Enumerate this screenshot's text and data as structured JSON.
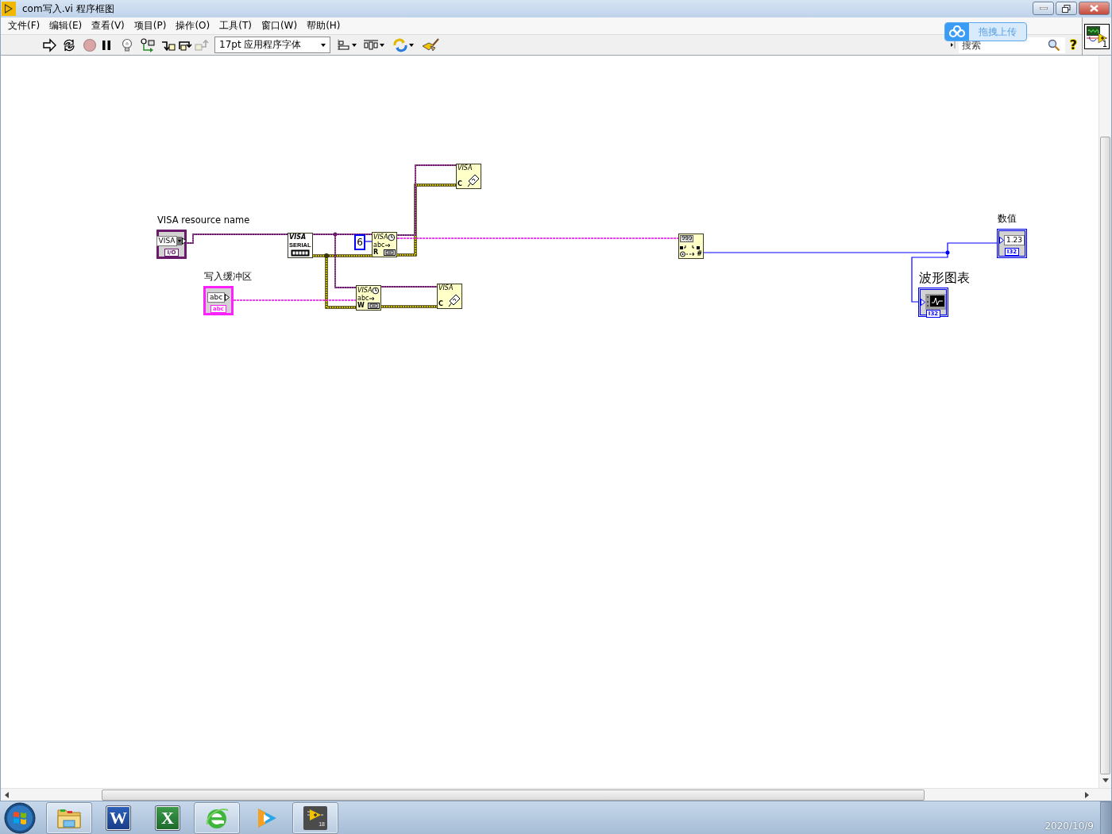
{
  "window": {
    "title": "com写入.vi 程序框图"
  },
  "menu": [
    "文件(F)",
    "编辑(E)",
    "查看(V)",
    "项目(P)",
    "操作(O)",
    "工具(T)",
    "窗口(W)",
    "帮助(H)"
  ],
  "toolbar": {
    "buttons": [
      {
        "kind": "run",
        "disabled": false
      },
      {
        "kind": "run_continuously",
        "disabled": false
      },
      {
        "kind": "abort",
        "disabled": true
      },
      {
        "kind": "pause",
        "disabled": false
      },
      {
        "kind": "highlight",
        "disabled": false
      },
      {
        "kind": "retain",
        "disabled": false
      },
      {
        "kind": "step_into",
        "disabled": false
      },
      {
        "kind": "step_over",
        "disabled": false
      },
      {
        "kind": "step_out",
        "disabled": true
      }
    ],
    "font": "17pt 应用程序字体",
    "search": {
      "placeholder": "搜索"
    },
    "help": "?"
  },
  "icon_pane": {
    "number": "1"
  },
  "upload_widget": {
    "label": "拖拽上传"
  },
  "diagram": {
    "terminals": [
      {
        "kind": "visa",
        "label": "VISA resource name",
        "display": "VISA",
        "type": "I/O",
        "indicator": false
      },
      {
        "kind": "numeric",
        "label": "数值",
        "display": "1.23",
        "type": "I32",
        "indicator": true
      },
      {
        "kind": "string",
        "label": "写入缓冲区",
        "display": "abc",
        "type": "abc",
        "indicator": false
      },
      {
        "kind": "chart",
        "label": "波形图表",
        "type": "I32",
        "indicator": true
      }
    ],
    "constants": [
      {
        "value": "6"
      }
    ],
    "nodes": [
      {
        "kind": "serial",
        "texts": [
          "VISA",
          "SERIAL"
        ]
      },
      {
        "kind": "read",
        "texts": [
          "VISA",
          "abc",
          "R"
        ]
      },
      {
        "kind": "close",
        "texts": [
          "VISA",
          "C"
        ]
      },
      {
        "kind": "write",
        "texts": [
          "VISA",
          "abc",
          "W"
        ]
      },
      {
        "kind": "close",
        "texts": [
          "VISA",
          "C"
        ]
      },
      {
        "kind": "convert",
        "texts": [
          "999",
          "#"
        ]
      }
    ]
  },
  "taskbar": {
    "apps": [
      {
        "kind": "explorer",
        "running": true
      },
      {
        "kind": "word",
        "running": false,
        "glyph": "W"
      },
      {
        "kind": "excel",
        "running": false,
        "glyph": "X"
      },
      {
        "kind": "browser",
        "running": true
      },
      {
        "kind": "video",
        "running": false
      },
      {
        "kind": "labview",
        "running": true,
        "badge": "18"
      }
    ],
    "date": "2020/10/9"
  }
}
